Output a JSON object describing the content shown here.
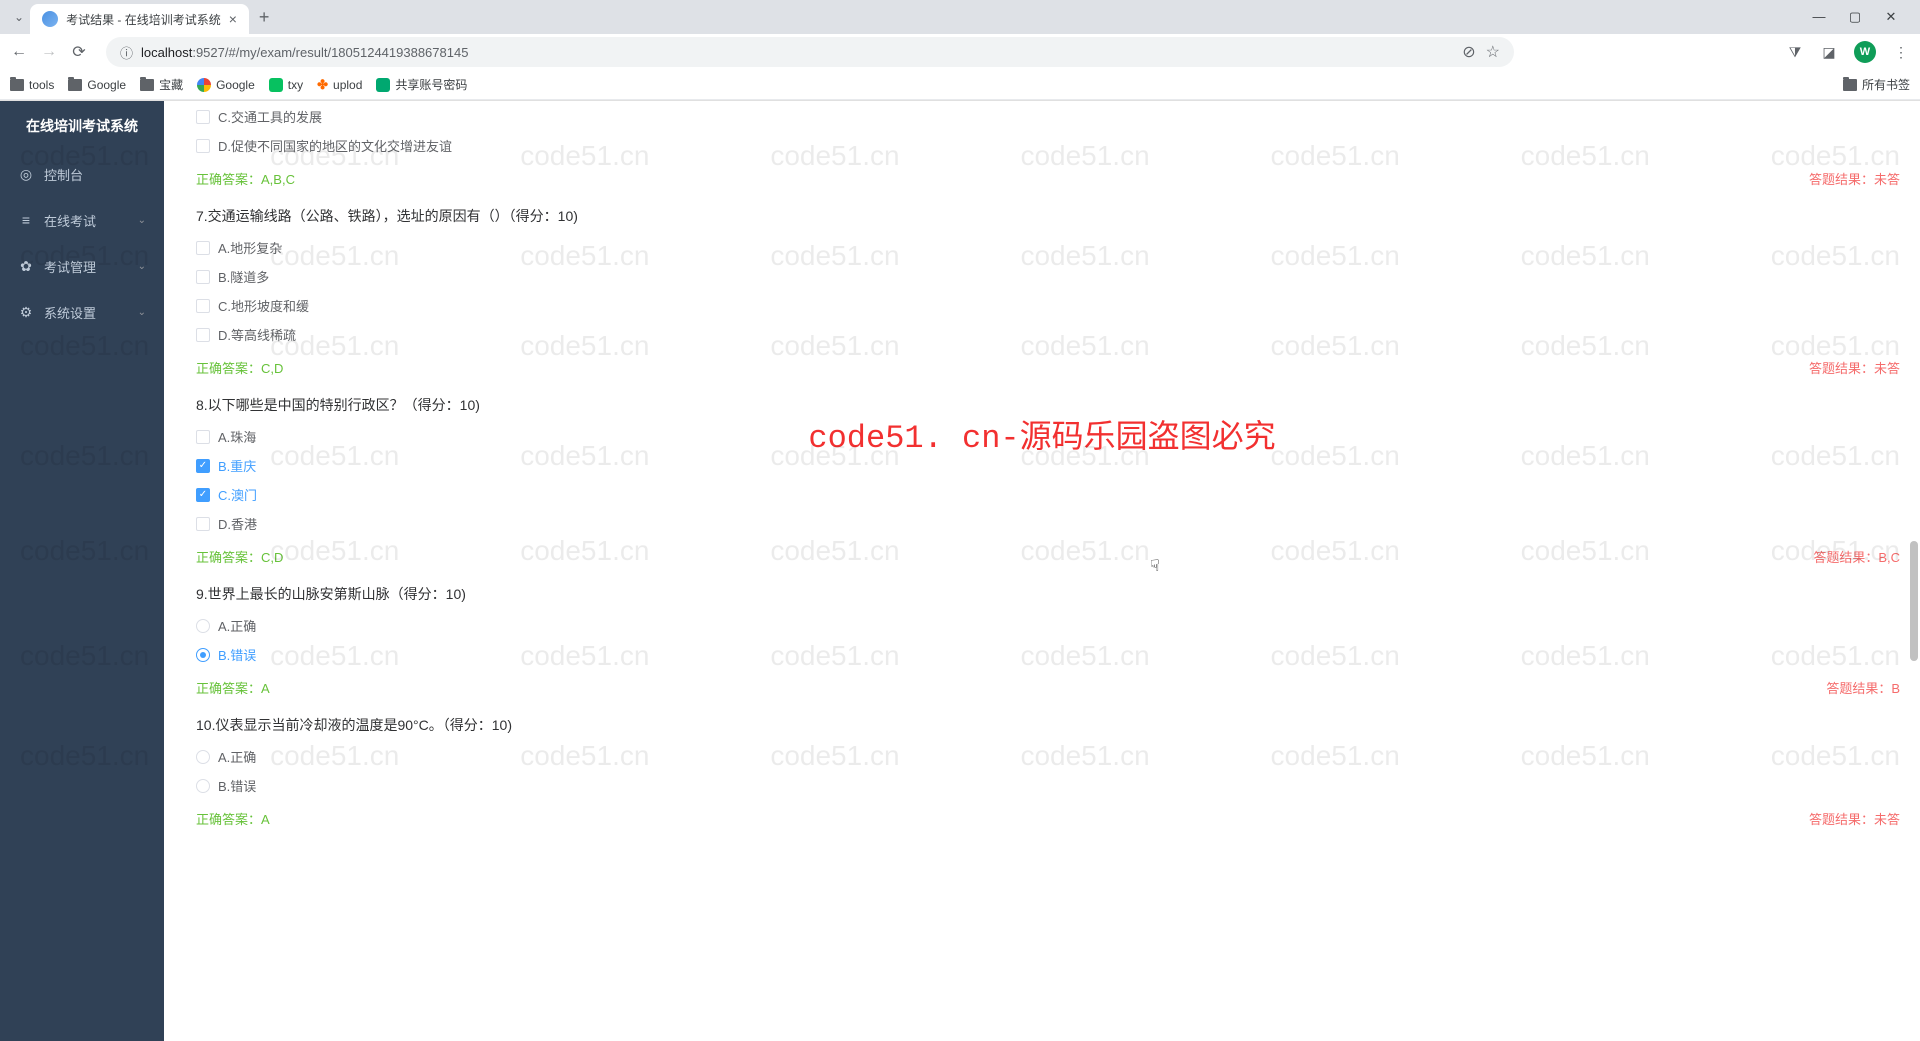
{
  "browser": {
    "tab_title": "考试结果 - 在线培训考试系统",
    "url_host": "localhost",
    "url_port": ":9527",
    "url_path": "/#/my/exam/result/1805124419388678145",
    "avatar_letter": "W",
    "bookmarks": [
      "tools",
      "Google",
      "宝藏",
      "Google",
      "txy",
      "uplod",
      "共享账号密码"
    ],
    "all_bookmarks": "所有书签"
  },
  "sidebar": {
    "title": "在线培训考试系统",
    "items": [
      {
        "icon": "◎",
        "label": "控制台",
        "expandable": false
      },
      {
        "icon": "≡",
        "label": "在线考试",
        "expandable": true
      },
      {
        "icon": "✿",
        "label": "考试管理",
        "expandable": true
      },
      {
        "icon": "⚙",
        "label": "系统设置",
        "expandable": true
      }
    ]
  },
  "questions": [
    {
      "partial_options": [
        {
          "label": "C.交通工具的发展",
          "checked": false
        },
        {
          "label": "D.促使不同国家的地区的文化交增进友谊",
          "checked": false
        }
      ],
      "correct": "正确答案：A,B,C",
      "result": "答题结果：未答"
    },
    {
      "title": "7.交通运输线路（公路、铁路），选址的原因有（）（得分：10)",
      "type": "checkbox",
      "options": [
        {
          "label": "A.地形复杂",
          "checked": false
        },
        {
          "label": "B.隧道多",
          "checked": false
        },
        {
          "label": "C.地形坡度和缓",
          "checked": false
        },
        {
          "label": "D.等高线稀疏",
          "checked": false
        }
      ],
      "correct": "正确答案：C,D",
      "result": "答题结果：未答"
    },
    {
      "title": "8.以下哪些是中国的特别行政区？（得分：10)",
      "type": "checkbox",
      "options": [
        {
          "label": "A.珠海",
          "checked": false
        },
        {
          "label": "B.重庆",
          "checked": true
        },
        {
          "label": "C.澳门",
          "checked": true
        },
        {
          "label": "D.香港",
          "checked": false
        }
      ],
      "correct": "正确答案：C,D",
      "result": "答题结果：B,C"
    },
    {
      "title": "9.世界上最长的山脉安第斯山脉（得分：10)",
      "type": "radio",
      "options": [
        {
          "label": "A.正确",
          "checked": false
        },
        {
          "label": "B.错误",
          "checked": true
        }
      ],
      "correct": "正确答案：A",
      "result": "答题结果：B"
    },
    {
      "title": "10.仪表显示当前冷却液的温度是90°C。（得分：10)",
      "type": "radio",
      "options": [
        {
          "label": "A.正确",
          "checked": false
        },
        {
          "label": "B.错误",
          "checked": false
        }
      ],
      "correct": "正确答案：A",
      "result": "答题结果：未答"
    }
  ],
  "watermark": {
    "repeat_text": "code51.cn",
    "overlay_text": "code51. cn-源码乐园盗图必究"
  }
}
